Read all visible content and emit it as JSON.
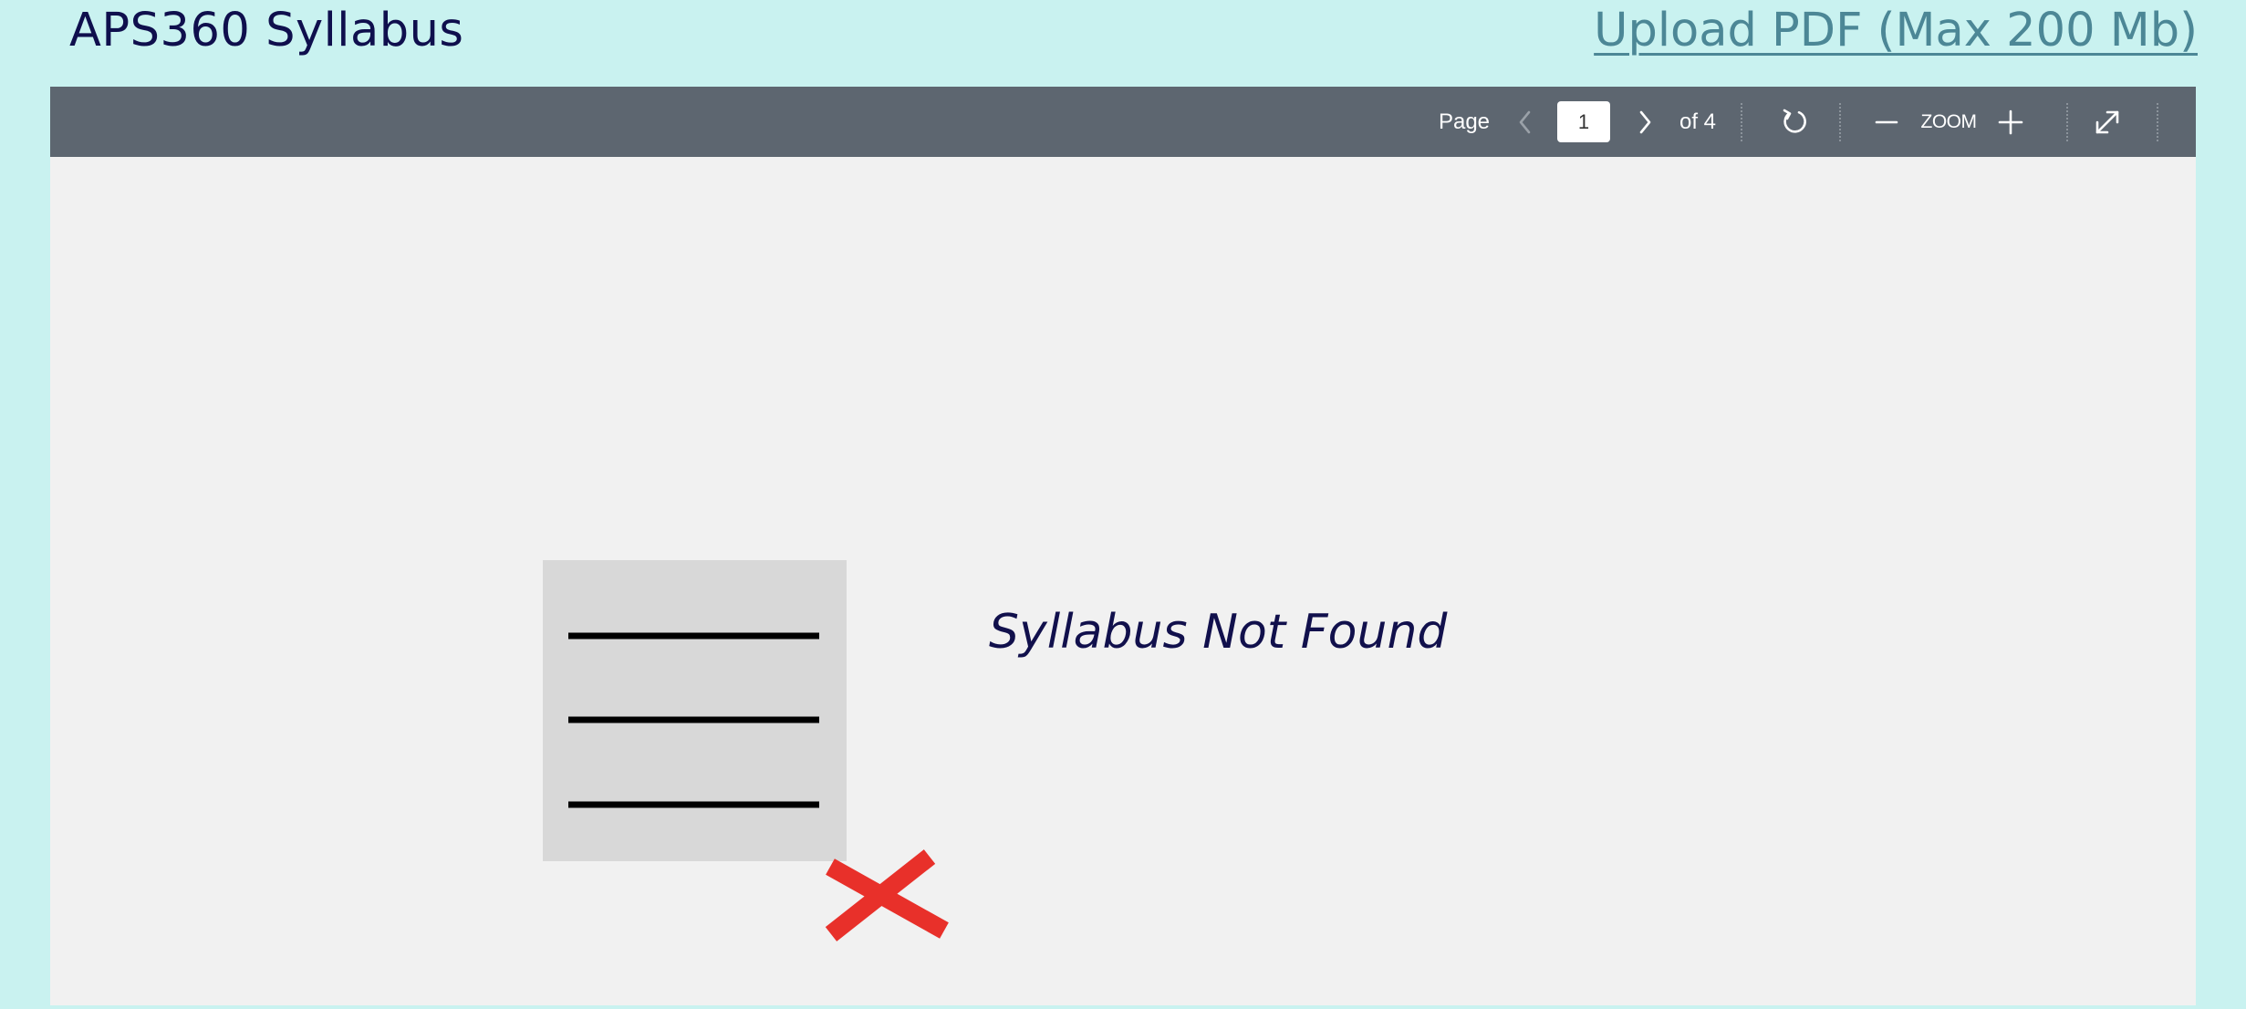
{
  "header": {
    "title": "APS360 Syllabus",
    "upload_label": "Upload PDF (Max 200 Mb)"
  },
  "toolbar": {
    "page_label": "Page",
    "current_page": "1",
    "total_pages_label": "of 4",
    "zoom_label": "ZOOM",
    "icons": {
      "prev": "chevron-left-icon",
      "next": "chevron-right-icon",
      "rotate": "rotate-icon",
      "zoom_out": "minus-icon",
      "zoom_in": "plus-icon",
      "fullscreen": "expand-icon"
    }
  },
  "content": {
    "message": "Syllabus Not Found",
    "icon": "document-not-found-icon"
  },
  "colors": {
    "page_background": "#c9f2f0",
    "title_color": "#0f0f4d",
    "link_color": "#4c8796",
    "toolbar_background": "#5d6670",
    "viewer_background": "#f1f1f1",
    "error_red": "#e8302a"
  }
}
